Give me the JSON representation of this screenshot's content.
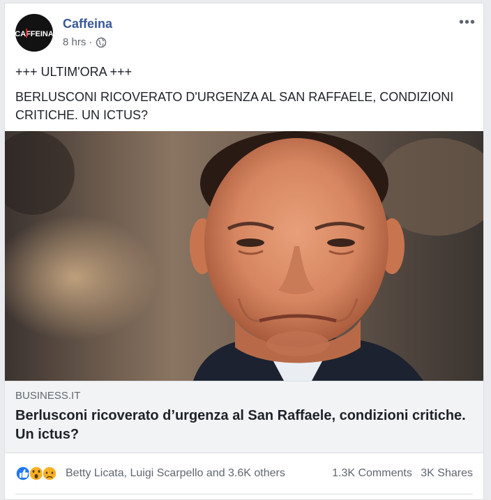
{
  "post": {
    "page_name": "Caffeina",
    "avatar_text": "CAFFEINA",
    "time": "8 hrs",
    "separator": "·",
    "audience_icon": "globe-icon",
    "more_icon": "more-options-icon",
    "more_label": "•••",
    "text_lines": [
      "+++ ULTIM'ORA +++",
      "BERLUSCONI RICOVERATO D'URGENZA AL SAN RAFFAELE, CONDIZIONI CRITICHE. UN ICTUS?"
    ]
  },
  "link_preview": {
    "domain": "BUSINESS.IT",
    "title": "Berlusconi ricoverato d’urgenza al San Raffaele, condizioni critiche. Un ictus?"
  },
  "engagement": {
    "reaction_icons": [
      "like-icon",
      "wow-icon",
      "sad-icon"
    ],
    "reactors": "Betty Licata, Luigi Scarpello and 3.6K others",
    "comments": "1.3K Comments",
    "shares": "3K Shares"
  },
  "colors": {
    "page_name": "#385898",
    "meta_text": "#606770",
    "card_bg": "#ffffff",
    "page_bg": "#e9ebee",
    "link_box_bg": "#f2f3f5",
    "like_blue": "#2078f4",
    "reaction_yellow": "#f7b125"
  }
}
